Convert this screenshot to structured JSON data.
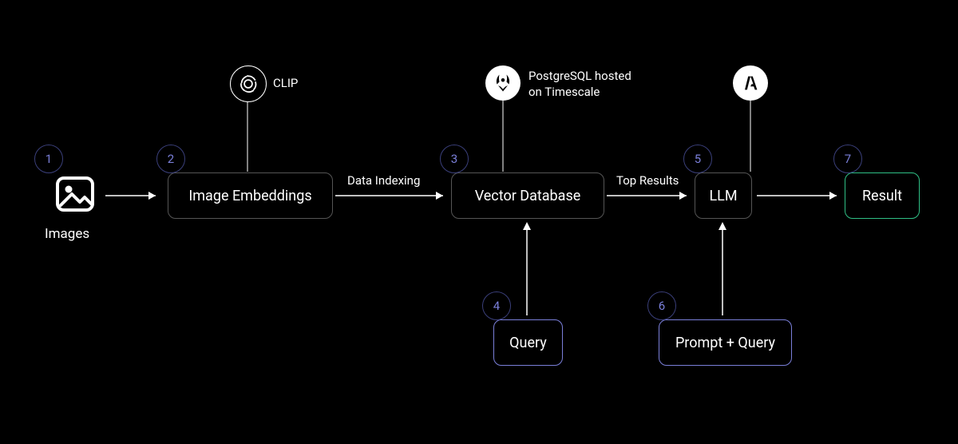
{
  "nodes": {
    "images_label": "Images",
    "image_embeddings": "Image Embeddings",
    "vector_database": "Vector Database",
    "llm": "LLM",
    "result": "Result",
    "query": "Query",
    "prompt_query": "Prompt + Query"
  },
  "badges": {
    "n1": "1",
    "n2": "2",
    "n3": "3",
    "n4": "4",
    "n5": "5",
    "n6": "6",
    "n7": "7"
  },
  "edges": {
    "data_indexing": "Data Indexing",
    "top_results": "Top Results"
  },
  "annotations": {
    "clip": "CLIP",
    "postgres_timescale": "PostgreSQL hosted\non Timescale"
  },
  "icons": {
    "images": "image-icon",
    "clip": "openai-icon",
    "timescale": "timescale-icon",
    "anthropic": "anthropic-icon"
  }
}
